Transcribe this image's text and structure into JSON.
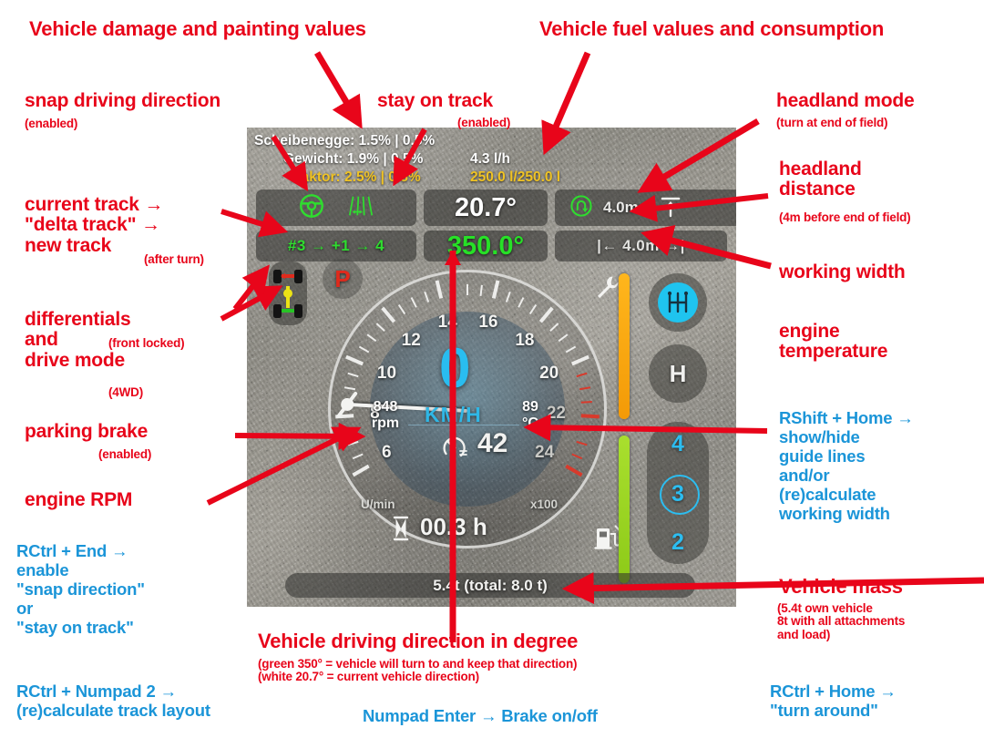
{
  "hud": {
    "damage": {
      "implement_label": "Scheibenegge: 1.5% | 0.5%",
      "weight_label": "Gewicht: 1.9% | 0.5%",
      "tractor_label": "Traktor: 2.5% | 0.8%"
    },
    "fuel": {
      "consumption": "4.3 l/h",
      "level": "250.0 l/250.0 l"
    },
    "status": {
      "snap_direction_icon": "steering-wheel-icon",
      "stay_on_track_icon": "track-lines-icon",
      "current_direction": "20.7°",
      "target_direction": "350.0°",
      "track_sequence": "#3 → +1 → 4",
      "headland_mode_icon": "u-turn-icon",
      "headland_distance": "4.0m",
      "headland_marker_icon": "arrow-up-line-icon",
      "working_width": "|← 4.0m →|"
    },
    "left_icons": {
      "differential_icon": "differential-4wd-icon",
      "parking_brake": "P"
    },
    "gauge": {
      "ticks": [
        "6",
        "8",
        "10",
        "12",
        "14",
        "16",
        "18",
        "20",
        "22",
        "24"
      ],
      "unit_left": "U/min",
      "unit_right": "x100",
      "speed": "0",
      "speed_unit": "KM/H",
      "rpm_value": "848",
      "rpm_unit": "rpm",
      "temp_value": "89",
      "temp_unit": "°C",
      "cruise_icon": "cruise-control-icon",
      "cruise_value": "42",
      "hours_icon": "hourglass-icon",
      "hours_value": "00.3 h"
    },
    "right_panel": {
      "wrench_icon": "wrench-icon",
      "fuel_pump_icon": "fuel-pump-icon",
      "damage_bar_color": "#f5a30f",
      "fuel_bar_color": "#9bd424",
      "shifter_icon": "gear-shifter-icon",
      "group_label": "H",
      "gears": [
        "4",
        "3",
        "2"
      ],
      "selected_gear": "3"
    },
    "mass": "5.4t (total: 8.0 t)"
  },
  "annotations": {
    "damage_title": "Vehicle damage and painting values",
    "fuel_title": "Vehicle fuel values and consumption",
    "snap_direction": "snap driving direction",
    "snap_direction_sub": "(enabled)",
    "stay_on_track": "stay on track",
    "stay_on_track_sub": "(enabled)",
    "headland_mode": "headland mode",
    "headland_mode_sub": "(turn at end of field)",
    "headland_distance": "headland\ndistance",
    "headland_distance_sub": "(4m before end of field)",
    "working_width": "working width",
    "track_flow": "current track →\n\"delta track\" →\nnew track",
    "track_flow_sub": "(after turn)",
    "differentials": "differentials\nand\ndrive mode",
    "differentials_sub1": "(front locked)",
    "differentials_sub2": "(4WD)",
    "parking_brake": "parking brake",
    "parking_brake_sub": "(enabled)",
    "engine_rpm": "engine RPM",
    "engine_temperature": "engine\ntemperature",
    "vehicle_mass": "Vehicle mass",
    "vehicle_mass_sub": "(5.4t own vehicle\n8t with all attachments\nand load)",
    "driving_direction": "Vehicle driving direction in degree",
    "driving_direction_sub": "(green 350° = vehicle will turn to and keep that direction)\n(white 20.7° = current vehicle direction)"
  },
  "keybinds": {
    "rctrl_end": "RCtrl + End →\nenable\n\"snap direction\"\nor\n\"stay on track\"",
    "rctrl_numpad2": "RCtrl + Numpad 2 →\n(re)calculate track layout",
    "numpad_enter": "Numpad Enter → Brake on/off",
    "rshift_home": "RShift + Home →\nshow/hide\nguide lines\nand/or\n(re)calculate\nworking width",
    "rctrl_home": "RCtrl + Home →\n\"turn around\""
  },
  "colors": {
    "annotation_red": "#e8051a",
    "keybind_blue": "#1b95d8",
    "active_green": "#2fdc2f",
    "speed_cyan": "#29bdf0",
    "fuel_yellow": "#f0c324"
  }
}
